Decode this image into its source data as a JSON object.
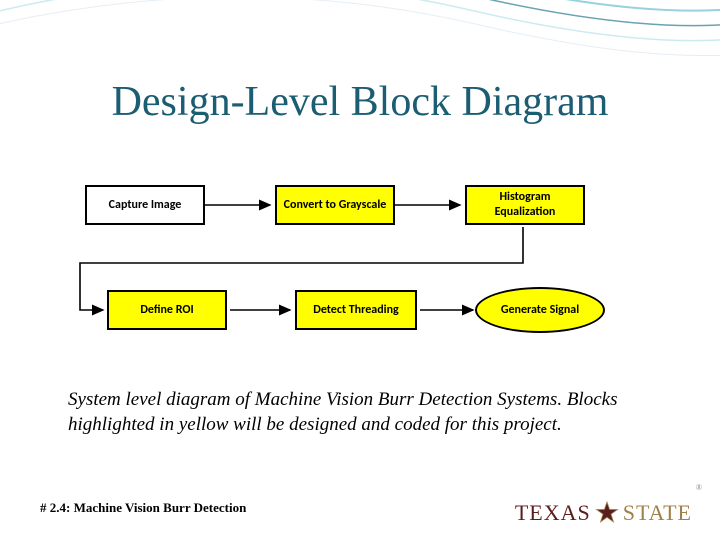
{
  "title": "Design-Level Block Diagram",
  "blocks": {
    "b1": "Capture Image",
    "b2": "Convert to Grayscale",
    "b3": "Histogram Equalization",
    "b4": "Define ROI",
    "b5": "Detect Threading",
    "b6": "Generate Signal"
  },
  "caption": "System level diagram of Machine Vision Burr Detection Systems. Blocks highlighted in yellow will be designed and coded for this project.",
  "footer_ref": "# 2.4: Machine Vision Burr Detection",
  "logo": {
    "part1": "TEXAS",
    "part2": "STATE"
  }
}
